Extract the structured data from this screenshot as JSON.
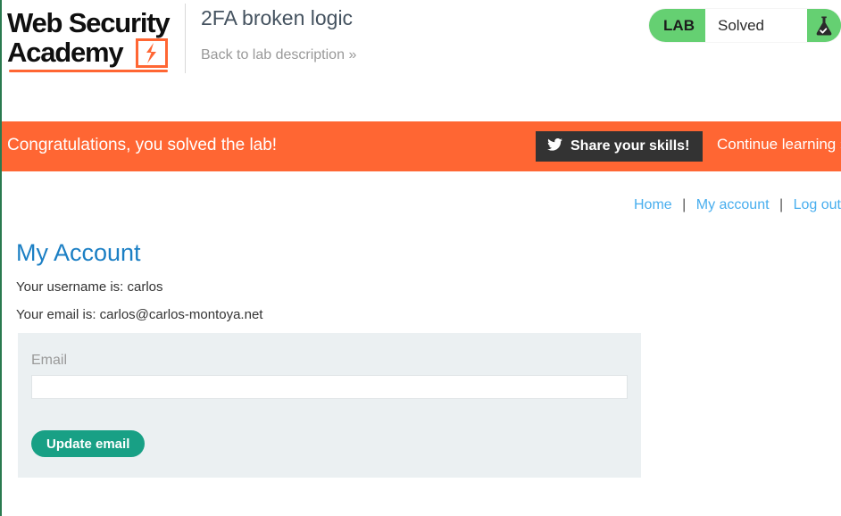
{
  "header": {
    "logo": {
      "line1": "Web Security",
      "line2": "Academy",
      "bolt_icon": "lightning-bolt-icon",
      "accent_color": "#ff6633"
    },
    "lab_title": "2FA broken logic",
    "back_link": "Back to lab description",
    "back_link_chevron": "»",
    "lab_status": {
      "label": "LAB",
      "value": "Solved",
      "flask_icon": "flask-check-icon",
      "badge_color": "#65d072"
    }
  },
  "banner": {
    "message": "Congratulations, you solved the lab!",
    "share_button": "Share your skills!",
    "share_icon": "twitter-bird-icon",
    "continue_link": "Continue learning",
    "continue_chevron": "»",
    "background_color": "#ff6633"
  },
  "nav": {
    "separator": "|",
    "links": [
      {
        "label": "Home"
      },
      {
        "label": "My account"
      },
      {
        "label": "Log out"
      }
    ]
  },
  "account": {
    "title": "My Account",
    "username_line": "Your username is: carlos",
    "email_line": "Your email is: carlos@carlos-montoya.net"
  },
  "form": {
    "email_label": "Email",
    "email_value": "",
    "email_placeholder": "",
    "submit_label": "Update email",
    "submit_color": "#18a085",
    "panel_color": "#ebf0f2"
  }
}
